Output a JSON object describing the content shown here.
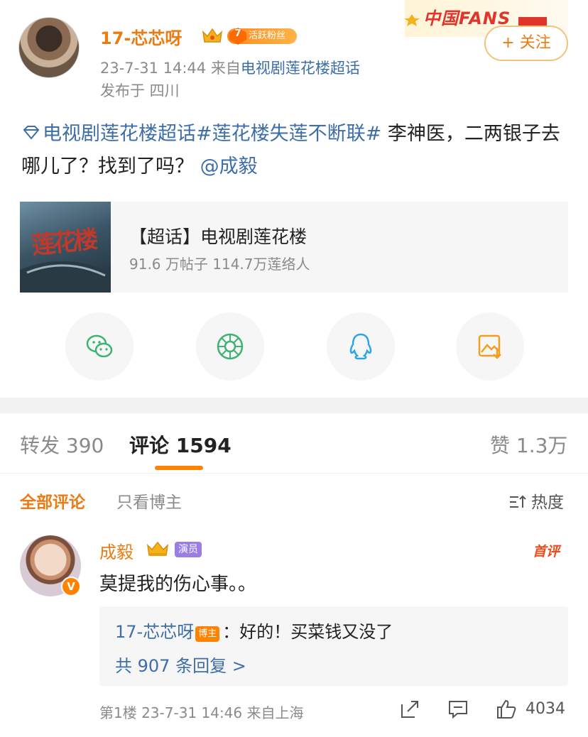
{
  "post": {
    "author": "17-芯芯呀",
    "fan_level": "7",
    "fan_badge": "活跃粉丝",
    "time": "23-7-31 14:44",
    "from_prefix": "来自",
    "source": "电视剧莲花楼超话",
    "location": "发布于 四川",
    "follow_label": "+ 关注",
    "banner": "中国FANS",
    "topic1": "电视剧莲花楼超话",
    "topic2": "#莲花楼失莲不断联#",
    "text": " 李神医，二两银子去哪儿了？找到了吗？",
    "mention": "@成毅"
  },
  "topic_card": {
    "thumb_text": "莲花楼",
    "title": "【超话】电视剧莲花楼",
    "stats": "91.6 万帖子  114.7万莲络人"
  },
  "share": [
    "wechat-icon",
    "moments-icon",
    "qq-icon",
    "save-image-icon"
  ],
  "tabs": {
    "repost": "转发 390",
    "comments": "评论 1594",
    "likes": "赞 1.3万"
  },
  "filters": {
    "all": "全部评论",
    "owner_only": "只看博主",
    "sort": "热度"
  },
  "comment": {
    "author": "成毅",
    "badge": "演员",
    "first": "首评",
    "v": "V",
    "text": "莫提我的伤心事。。",
    "reply_user": "17-芯芯呀",
    "reply_badge": "博主",
    "reply_text": "：好的！买菜钱又没了",
    "reply_more": "共 907 条回复 >",
    "footer": "第1楼  23-7-31 14:46  来自上海",
    "like_count": "4034"
  },
  "colors": {
    "accent": "#ff8200",
    "link": "#3d6ea8",
    "name": "#eb7b13"
  }
}
